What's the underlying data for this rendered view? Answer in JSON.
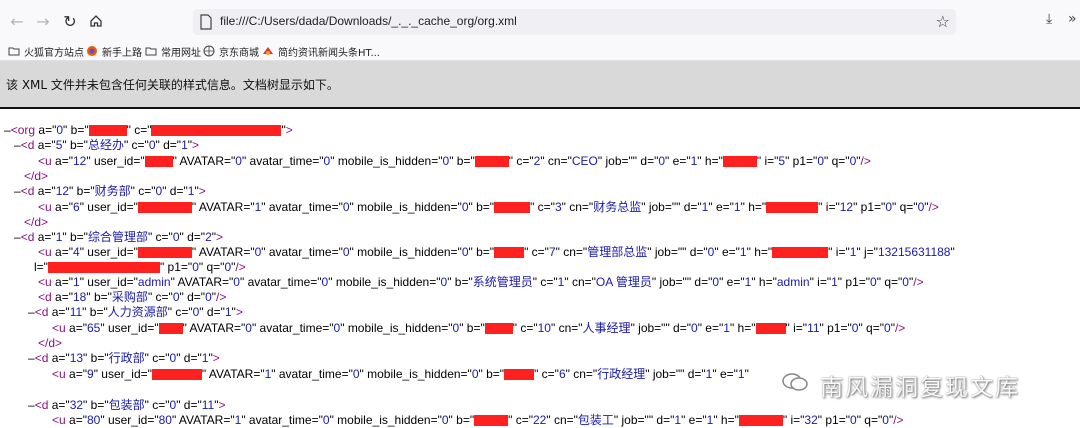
{
  "browser": {
    "url": "file:///C:/Users/dada/Downloads/_._._cache_org/org.xml",
    "bookmarks": [
      {
        "label": "火狐官方站点",
        "icon": "folder-icon"
      },
      {
        "label": "新手上路",
        "icon": "firefox-icon"
      },
      {
        "label": "常用网址",
        "icon": "folder-icon"
      },
      {
        "label": "京东商城",
        "icon": "globe-icon"
      },
      {
        "label": "简约资讯新闻头条HT...",
        "icon": "news-icon"
      }
    ]
  },
  "info_message": "该 XML 文件并未包含任何关联的样式信息。文档树显示如下。",
  "xml": {
    "root": {
      "a": "0"
    },
    "d5": {
      "a": "5",
      "b": "总经办",
      "c": "0",
      "d": "1",
      "u": {
        "a": "12",
        "avatar": "0",
        "avatar_time": "0",
        "mobile_is_hidden": "0",
        "c": "2",
        "cn": "CEO",
        "job": "",
        "d": "0",
        "e": "1",
        "i": "5",
        "p1": "0",
        "q": "0"
      }
    },
    "d12": {
      "a": "12",
      "b": "财务部",
      "c": "0",
      "d": "1",
      "u": {
        "a": "6",
        "avatar": "1",
        "avatar_time": "0",
        "mobile_is_hidden": "0",
        "c": "3",
        "cn": "财务总监",
        "job": "",
        "d": "1",
        "e": "1",
        "i": "12",
        "p1": "0",
        "q": "0"
      }
    },
    "d1": {
      "a": "1",
      "b": "综合管理部",
      "c": "0",
      "d": "2",
      "u1": {
        "a": "4",
        "avatar": "0",
        "avatar_time": "0",
        "mobile_is_hidden": "0",
        "c": "7",
        "cn": "管理部总监",
        "job": "",
        "d": "0",
        "e": "1",
        "i": "1",
        "j": "13215631188",
        "p1": "0",
        "q": "0"
      },
      "u2": {
        "a": "1",
        "user_id": "admin",
        "avatar": "0",
        "avatar_time": "0",
        "mobile_is_hidden": "0",
        "b": "系统管理员",
        "c": "1",
        "cn": "OA 管理员",
        "job": "",
        "d": "0",
        "e": "1",
        "h": "admin",
        "i": "1",
        "p1": "0",
        "q": "0"
      }
    },
    "d18": {
      "a": "18",
      "b": "采购部",
      "c": "0",
      "d": "0"
    },
    "d11": {
      "a": "11",
      "b": "人力资源部",
      "c": "0",
      "d": "1",
      "u": {
        "a": "65",
        "avatar": "0",
        "avatar_time": "0",
        "mobile_is_hidden": "0",
        "c": "10",
        "cn": "人事经理",
        "job": "",
        "d": "0",
        "e": "1",
        "i": "11",
        "p1": "0",
        "q": "0"
      }
    },
    "d13": {
      "a": "13",
      "b": "行政部",
      "c": "0",
      "d": "1",
      "u": {
        "a": "9",
        "avatar": "1",
        "avatar_time": "0",
        "mobile_is_hidden": "0",
        "c": "6",
        "cn": "行政经理",
        "job": "",
        "d": "1",
        "e": "1",
        "i": "13"
      }
    },
    "d32": {
      "a": "32",
      "b": "包装部",
      "c": "0",
      "d": "11",
      "u": {
        "a": "80",
        "user_id": "80",
        "avatar": "1",
        "avatar_time": "0",
        "mobile_is_hidden": "0",
        "c": "22",
        "cn": "包装工",
        "job": "",
        "d": "1",
        "e": "1",
        "i": "32",
        "p1": "0",
        "q": "0"
      }
    }
  },
  "watermark": "南风漏洞复现文库",
  "colors": {
    "redaction": "#ff2020",
    "tag": "#881280",
    "value": "#1a1aa6"
  }
}
